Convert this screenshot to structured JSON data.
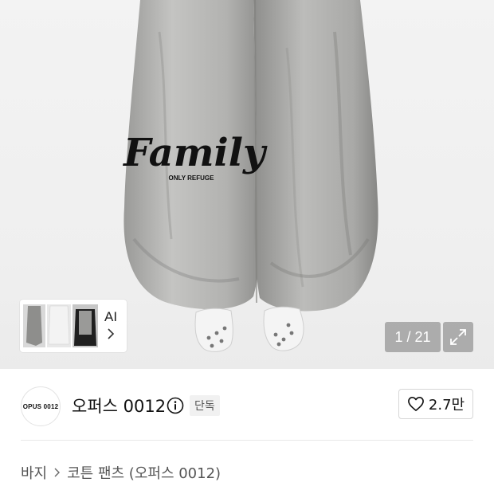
{
  "hero": {
    "print_text": "Family",
    "print_subtext": "ONLY REFUGE",
    "gallery_preview_label": "AI",
    "pager": "1 / 21"
  },
  "brand": {
    "logo_text": "OPUS 0012",
    "name": "오퍼스 0012",
    "badge": "단독",
    "like_count": "2.7만"
  },
  "breadcrumb": {
    "category": "바지",
    "product": "코튼 팬츠 (오퍼스 0012)"
  },
  "icons": {
    "info": "info-icon",
    "expand": "expand-icon",
    "heart": "heart-outline-icon",
    "chevron": "chevron-right-icon"
  },
  "colors": {
    "pager_bg": "#787878",
    "badge_bg": "#f1f1f1",
    "divider": "#e8e8e8"
  }
}
